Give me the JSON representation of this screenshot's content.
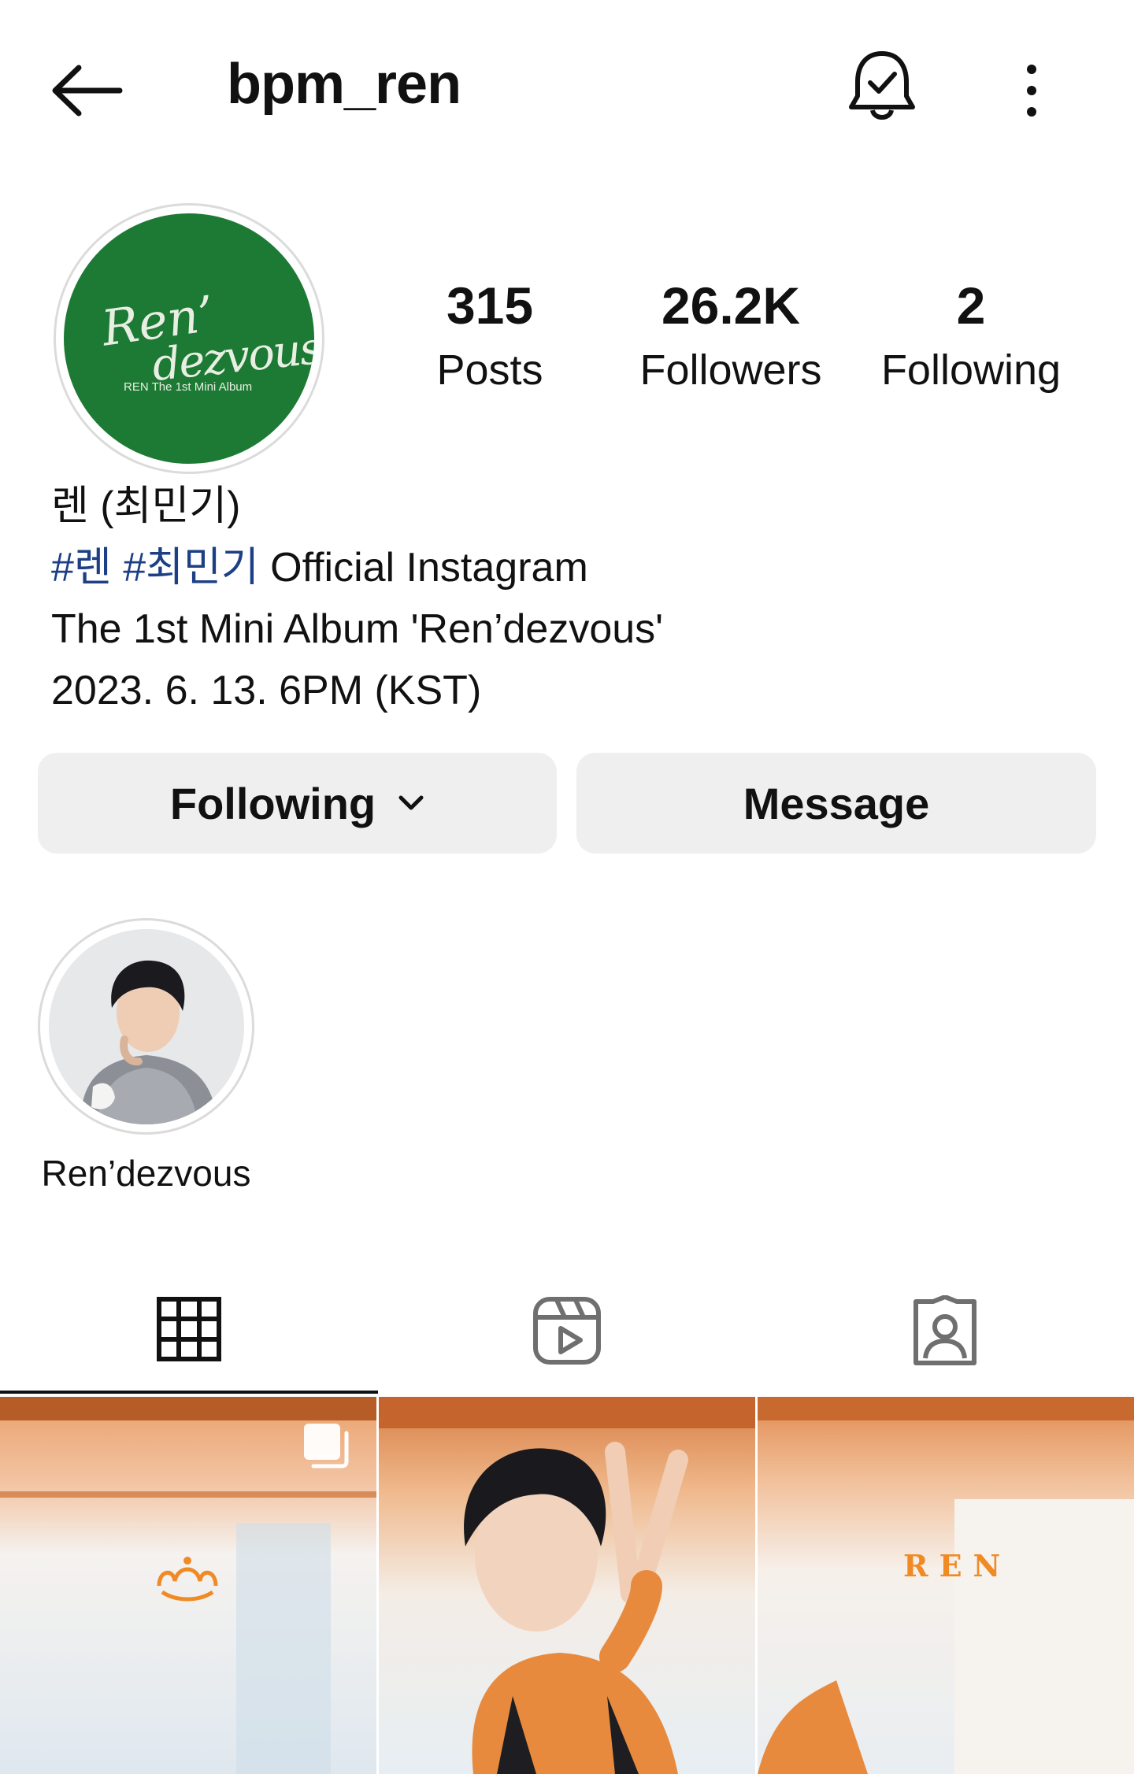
{
  "header": {
    "username": "bpm_ren",
    "back_icon": "arrow-left-icon",
    "notifications_icon": "bell-check-icon",
    "more_icon": "more-vertical-icon"
  },
  "profile": {
    "avatar_text_line1": "Ren’",
    "avatar_text_line2": "dezvous",
    "avatar_text_line3": "REN The 1st Mini Album",
    "avatar_color": "#1d7a35",
    "stats": {
      "posts_count": "315",
      "posts_label": "Posts",
      "followers_count": "26.2K",
      "followers_label": "Followers",
      "following_count": "2",
      "following_label": "Following"
    },
    "bio": {
      "name": "렌 (최민기)",
      "hashtag1": "#렌",
      "hashtag2": "#최민기",
      "line2_text": " Official Instagram",
      "line3": "The 1st Mini Album 'Ren’dezvous'",
      "line4": "2023. 6. 13. 6PM (KST)"
    }
  },
  "actions": {
    "following_label": "Following",
    "message_label": "Message"
  },
  "highlights": [
    {
      "label": "Ren’dezvous"
    }
  ],
  "tabs": {
    "grid_icon": "grid-icon",
    "reels_icon": "reels-icon",
    "tagged_icon": "tagged-person-icon",
    "active": "grid"
  },
  "posts": {
    "post1_logo": "crown-logo",
    "post3_logo": "REN",
    "post1_multi_icon": "multiple-photos-icon"
  }
}
